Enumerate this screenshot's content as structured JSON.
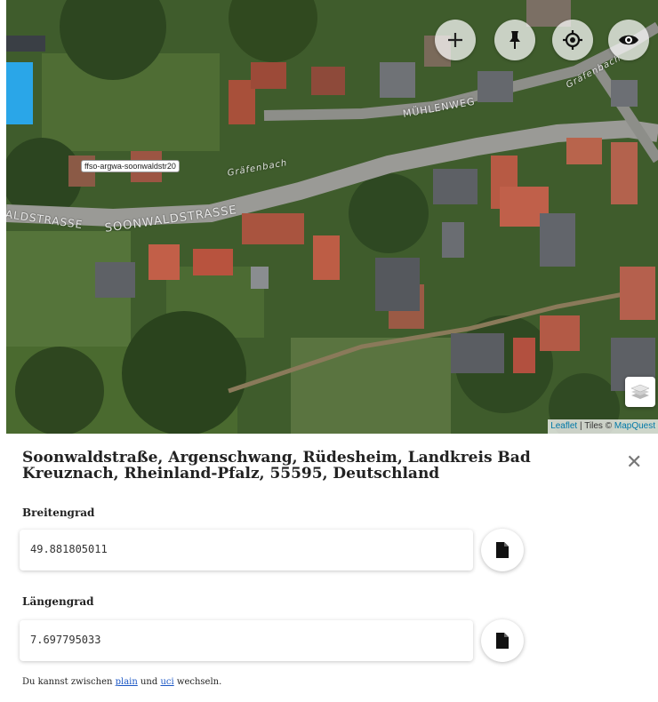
{
  "map": {
    "marker_label": "ffso-argwa-soonwaldstr20",
    "streets": {
      "soonwaldstrasse_left": "ALDSTRASSE",
      "soonwaldstrasse": "SOONWALDSTRASSE",
      "muehlenweg": "MÜHLENWEG",
      "graefenbach_1": "Gräfenbach",
      "graefenbach_2": "Gräfenbach"
    },
    "controls": {
      "zoom_in_icon": "plus-icon",
      "pin_icon": "pushpin-icon",
      "locate_icon": "crosshair-icon",
      "eye_icon": "eye-icon",
      "layers_icon": "layers-icon"
    },
    "attribution": {
      "leaflet": "Leaflet",
      "separator": " | Tiles © ",
      "provider": "MapQuest"
    }
  },
  "panel": {
    "address": "Soonwaldstraße, Argenschwang, Rüdesheim, Landkreis Bad Kreuznach, Rheinland-Pfalz, 55595, Deutschland",
    "close_symbol": "✕",
    "latitude_label": "Breitengrad",
    "latitude_value": "49.881805011",
    "longitude_label": "Längengrad",
    "longitude_value": "7.697795033",
    "copy_icon": "file-copy-icon",
    "footnote": {
      "prefix": "Du kannst zwischen ",
      "link_plain": "plain",
      "middle": " und ",
      "link_uci": "uci",
      "suffix": " wechseln."
    }
  }
}
